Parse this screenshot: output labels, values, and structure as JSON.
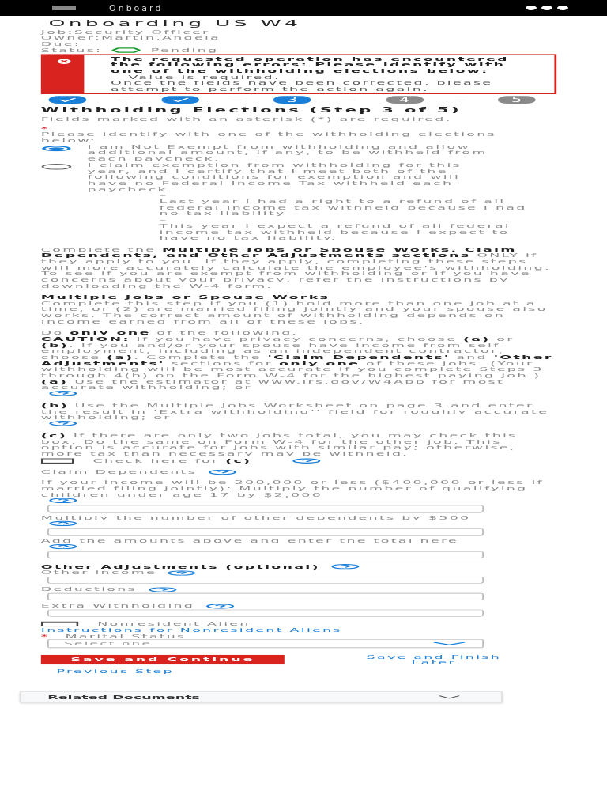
{
  "app_bar": {
    "title": "Onboard"
  },
  "header": {
    "title": "Onboarding US W4",
    "meta": [
      {
        "label": "Job:",
        "value": "Security Officer"
      },
      {
        "label": "Owner:",
        "value": "Martin,Angela"
      },
      {
        "label": "Due:"
      }
    ],
    "status": {
      "label": "Status:",
      "value": "Pending"
    }
  },
  "error": {
    "heading": "The requested operation has encountered the following errors: Please identify with one of the withholding elections below:",
    "detail": "Value is required.",
    "footer": "Once the fields have been corrected, please attempt to perform the action again."
  },
  "steps": [
    {
      "kind": "done"
    },
    {
      "kind": "done"
    },
    {
      "kind": "current",
      "label": "3"
    },
    {
      "kind": "todo",
      "label": "4"
    },
    {
      "kind": "todo",
      "label": "5"
    }
  ],
  "section_title": "Withholding Elections (Step 3 of 5)",
  "required_note": "Fields marked with an asterisk (*) are required.",
  "required_mark": "*",
  "elections": {
    "prompt": "Please identify with one of the withholding elections below:",
    "options": [
      {
        "label": "I am Not Exempt from withholding and allow additional amount, if any, to be withheld from each paycheck.",
        "selected": true
      },
      {
        "label": "I claim exemption from withholding for this year, and I certify that I meet both of the following conditions for exemption and will have no Federal Income Tax withheld each paycheck.",
        "selected": false,
        "conditions": [
          {
            "marker": "–",
            "text": "Last year I had a right to a refund of all federal income tax withheld because I had no tax liability"
          },
          {
            "marker": "–",
            "text": "This year I expect a refund of all federal income tax withheld because I expect to have no tax liability."
          }
        ]
      }
    ]
  },
  "intro": "Complete the **Multiple Jobs or Spouse Works, Claim Dependents, and Other Adjustments sections** ONLY if they apply to you. If they apply, completing these steps will more accurately calculate the employee's withholding. To see if you are exempt from withholding or if you have concerns about your privacy, refer the instructions by downloading the W-4 form.",
  "multiple_jobs": {
    "heading": "Multiple Jobs or Spouse Works",
    "text": "Complete this step if you (1) hold more than one job at a time, or (2) are married filing jointly and your spouse also works. The correct amount of withholding depends on income earned from all of these jobs.",
    "choose": "Do **only one** of the following.",
    "caution": "**CAUTION:** If you have privacy concerns, choose **(a)** or **(b)**. If you and/or your spouse have income from self-employment, including as an independent contractor, choose **(a)**. Complete the **'Claim Dependents'** and **'Other Adjustments'** sections for **only one** of these jobs. (Your withholding will be most accurate if you complete Steps 3 through 4(b) on the Form W-4 for the highest paying job.)",
    "options": [
      {
        "text": "**(a)** Use the estimator at www.irs.gov/W4App for most accurate withholding; or",
        "help": true
      },
      {
        "text": "**(b)** Use the Multiple Jobs Worksheet on page 3 and enter the result in 'Extra withholding'' field for roughly accurate withholding; or",
        "help": true
      },
      {
        "text": "**(c)** If there are only two jobs total, you may check this box. Do the same on Form W-4 for the other job. This option is accurate for jobs with similar pay; otherwise, more tax than necessary may be withheld.",
        "help": false
      }
    ],
    "checkbox": {
      "label": "Check here for **(c)**",
      "checked": false
    }
  },
  "dependents": {
    "heading": "Claim Dependents",
    "fields": [
      {
        "label": "If your income will be 200,000 or less ($400,000 or less if married filing jointly): Multiply the number of qualifying children under age 17 by $2,000"
      },
      {
        "label": "Multiply the number of other dependents by $500"
      },
      {
        "label": "Add the amounts above and enter the total here"
      }
    ]
  },
  "adjustments": {
    "heading": "Other Adjustments (optional)",
    "fields": [
      {
        "label": "Other income"
      },
      {
        "label": "Deductions"
      },
      {
        "label": "Extra Withholding"
      }
    ]
  },
  "nonresident": {
    "label": "Nonresident Alien",
    "checked": false,
    "link": "Instructions for Nonresident Aliens"
  },
  "marital": {
    "label": "Marital Status",
    "placeholder": "Select one"
  },
  "actions": {
    "primary": "Save and Continue",
    "secondary": "Save and Finish Later",
    "back": "Previous Step"
  },
  "related": {
    "title": "Related Documents",
    "expanded": false
  }
}
